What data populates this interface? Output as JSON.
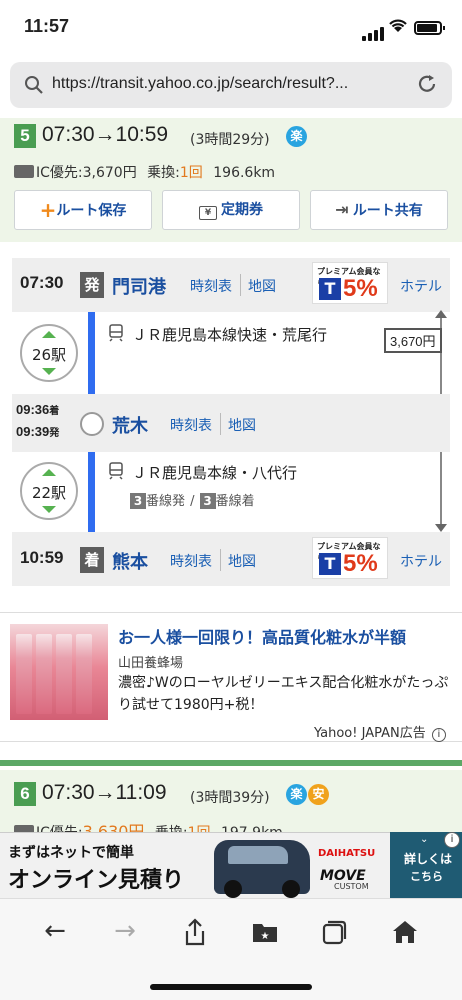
{
  "status_bar": {
    "time": "11:57"
  },
  "browser": {
    "url": "https://transit.yahoo.co.jp/search/result?...",
    "toolbar": {
      "back": "←",
      "forward": "→",
      "share": "⇧",
      "bookmarks": "★",
      "tabs": "❐",
      "home": "⌂"
    }
  },
  "route5": {
    "number": "5",
    "times": "07:30→10:59",
    "duration": "(3時間29分)",
    "badge": "楽",
    "fare_label": "IC優先:3,670円",
    "transfer_label": "乗換:",
    "transfer_count": "1回",
    "distance": "196.6km",
    "buttons": {
      "save": "ルート保存",
      "pass": "定期券",
      "share": "ルート共有"
    },
    "fare_total": "3,670円",
    "stations": [
      {
        "time": "07:30",
        "tag": "発",
        "name": "門司港",
        "timetable": "時刻表",
        "map": "地図",
        "hotel": "ホテル"
      },
      {
        "time_arr": "09:36",
        "arr": "着",
        "time_dep": "09:39",
        "dep": "発",
        "name": "荒木",
        "timetable": "時刻表",
        "map": "地図"
      },
      {
        "time": "10:59",
        "tag": "着",
        "name": "熊本",
        "timetable": "時刻表",
        "map": "地図",
        "hotel": "ホテル"
      }
    ],
    "segments": [
      {
        "stops": "26駅",
        "train": "ＪＲ鹿児島本線快速・荒尾行"
      },
      {
        "stops": "22駅",
        "train": "ＪＲ鹿児島本線・八代行",
        "plat_dep_num": "3",
        "plat_dep": "番線発",
        "plat_sep": "/",
        "plat_arr_num": "3",
        "plat_arr": "番線着"
      }
    ],
    "promo": {
      "text": "プレミアム会員なら",
      "t": "T",
      "pct": "5%",
      "sub": "T-POINT"
    }
  },
  "ad": {
    "title": "お一人様一回限り！高品質化粧水が半額",
    "advertiser": "山田養蜂場",
    "body": "濃密♪Wのローヤルゼリーエキス配合化粧水がたっぷり試せて1980円+税！",
    "footer": "Yahoo! JAPAN広告"
  },
  "route6": {
    "number": "6",
    "times": "07:30→11:09",
    "duration": "(3時間39分)",
    "badge1": "楽",
    "badge2": "安",
    "fare_label": "IC優先:",
    "fare_value": "3,630円",
    "transfer_label": "乗換:",
    "transfer_count": "1回",
    "distance": "197.9km"
  },
  "banner": {
    "line1": "まずはネットで簡単",
    "line2": "オンライン見積り",
    "brand": "DAIHATSU",
    "model": "MOVE",
    "model_sub": "CUSTOM",
    "cta1": "詳しくは",
    "cta2": "こちら"
  },
  "colors": {
    "accent_green": "#4a9d52",
    "link_blue": "#1a4fa0",
    "line_blue": "#2f6cf0",
    "orange": "#e2791e"
  }
}
